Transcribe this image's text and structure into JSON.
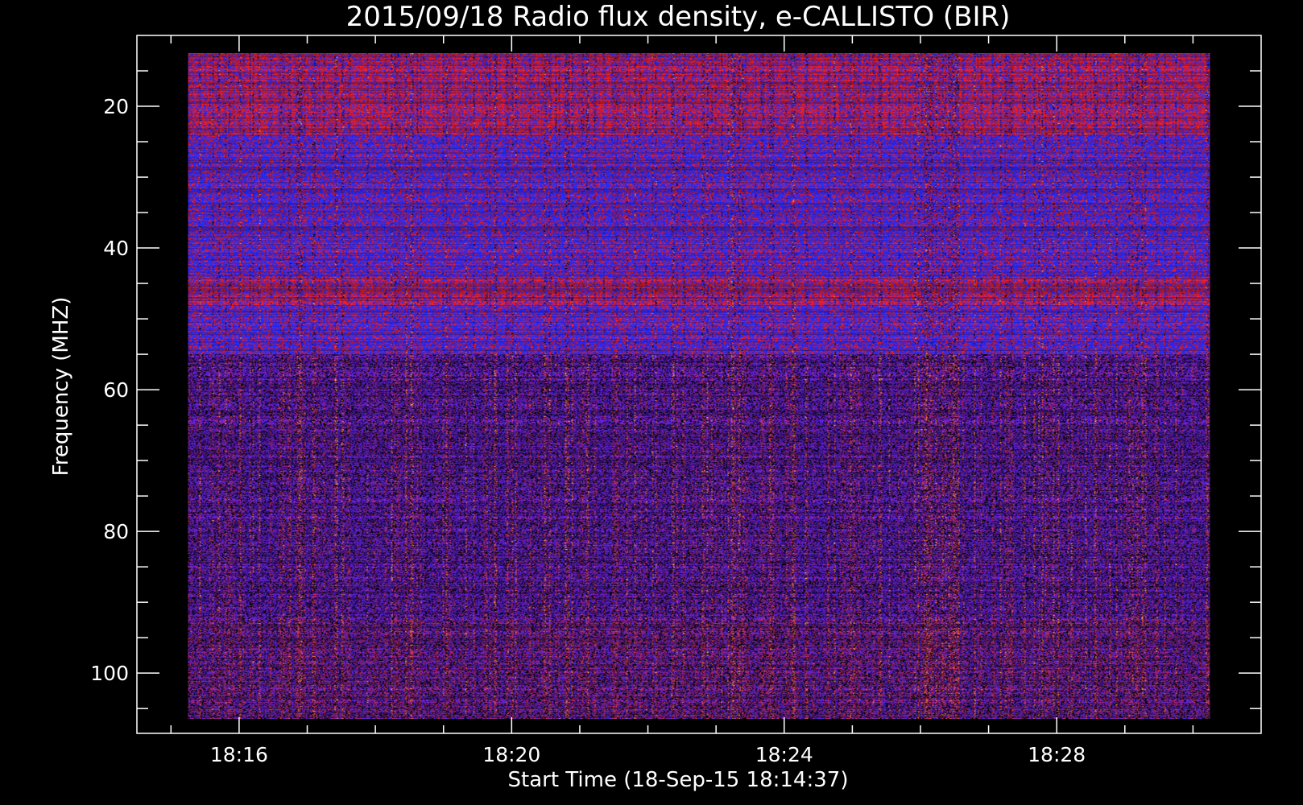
{
  "chart_data": {
    "type": "heatmap",
    "title": "2015/09/18  Radio flux density, e-CALLISTO (BIR)",
    "xlabel": "Start Time (18-Sep-15 18:14:37)",
    "ylabel": "Frequency (MHZ)",
    "x_ticks": [
      "18:16",
      "18:20",
      "18:24",
      "18:28"
    ],
    "x_tick_values_min": [
      16,
      20,
      24,
      28
    ],
    "x_range_min": [
      14.5,
      31.0
    ],
    "x_data_range_min": [
      15.25,
      30.25
    ],
    "y_ticks": [
      "20",
      "40",
      "60",
      "80",
      "100"
    ],
    "y_tick_values": [
      20,
      40,
      60,
      80,
      100
    ],
    "y_range": [
      10,
      108.5
    ],
    "y_data_range": [
      12.5,
      106.5
    ],
    "y_inverted": true,
    "bands": [
      {
        "freq_from": 12.5,
        "freq_to": 24,
        "level": "high"
      },
      {
        "freq_from": 24,
        "freq_to": 44,
        "level": "low"
      },
      {
        "freq_from": 44,
        "freq_to": 48,
        "level": "high"
      },
      {
        "freq_from": 48,
        "freq_to": 55,
        "level": "low"
      },
      {
        "freq_from": 55,
        "freq_to": 106.5,
        "level": "medium"
      }
    ],
    "colors": {
      "background": "#000000",
      "axis": "#ffffff",
      "high": "#d81c1c",
      "low": "#1e28ff",
      "medium": "#4a1fb8",
      "speckle": "#f2a03c"
    }
  }
}
